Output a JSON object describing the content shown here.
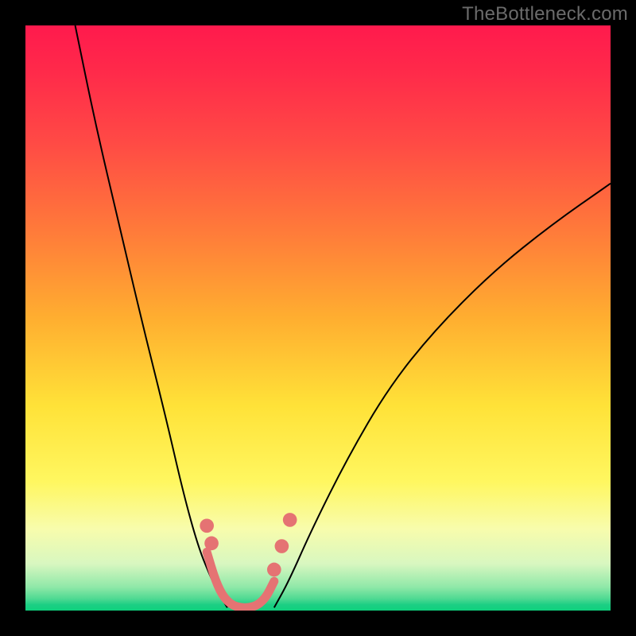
{
  "attribution": "TheBottleneck.com",
  "chart_data": {
    "type": "line",
    "title": "",
    "xlabel": "",
    "ylabel": "",
    "xlim": [
      0,
      100
    ],
    "ylim": [
      0,
      100
    ],
    "grid": false,
    "legend": false,
    "background_gradient": {
      "stops": [
        {
          "pos": 0.0,
          "color": "#ff1a4d"
        },
        {
          "pos": 0.35,
          "color": "#ff7a3a"
        },
        {
          "pos": 0.65,
          "color": "#ffe238"
        },
        {
          "pos": 0.86,
          "color": "#f8fcac"
        },
        {
          "pos": 0.96,
          "color": "#8fe8a8"
        },
        {
          "pos": 1.0,
          "color": "#0fd07d"
        }
      ]
    },
    "series": [
      {
        "name": "left-arm",
        "color": "#000000",
        "stroke_width": 2,
        "x": [
          8.5,
          12,
          16,
          20,
          24,
          27,
          29.5,
          31.5,
          33,
          34.5
        ],
        "y": [
          100,
          83,
          66,
          49,
          33,
          20,
          11,
          6,
          3,
          0.5
        ]
      },
      {
        "name": "right-arm",
        "color": "#000000",
        "stroke_width": 2,
        "x": [
          42.5,
          45,
          49,
          55,
          62,
          70,
          80,
          90,
          100
        ],
        "y": [
          0.5,
          5,
          14,
          26,
          38,
          48,
          58,
          66,
          73
        ]
      },
      {
        "name": "valley-floor",
        "color": "#e57373",
        "stroke_width": 11,
        "linecap": "round",
        "x": [
          31,
          32.5,
          34,
          36,
          39,
          41,
          42.5
        ],
        "y": [
          10,
          5,
          2,
          0.5,
          0.5,
          2,
          5
        ]
      }
    ],
    "markers": [
      {
        "name": "left-dot-upper",
        "x": 31,
        "y": 14.5,
        "r": 1.2,
        "color": "#e57373"
      },
      {
        "name": "left-dot-lower",
        "x": 31.8,
        "y": 11.5,
        "r": 1.2,
        "color": "#e57373"
      },
      {
        "name": "right-dot-a",
        "x": 42.5,
        "y": 7,
        "r": 1.2,
        "color": "#e57373"
      },
      {
        "name": "right-dot-b",
        "x": 43.8,
        "y": 11,
        "r": 1.2,
        "color": "#e57373"
      },
      {
        "name": "right-dot-c",
        "x": 45.2,
        "y": 15.5,
        "r": 1.2,
        "color": "#e57373"
      }
    ]
  }
}
